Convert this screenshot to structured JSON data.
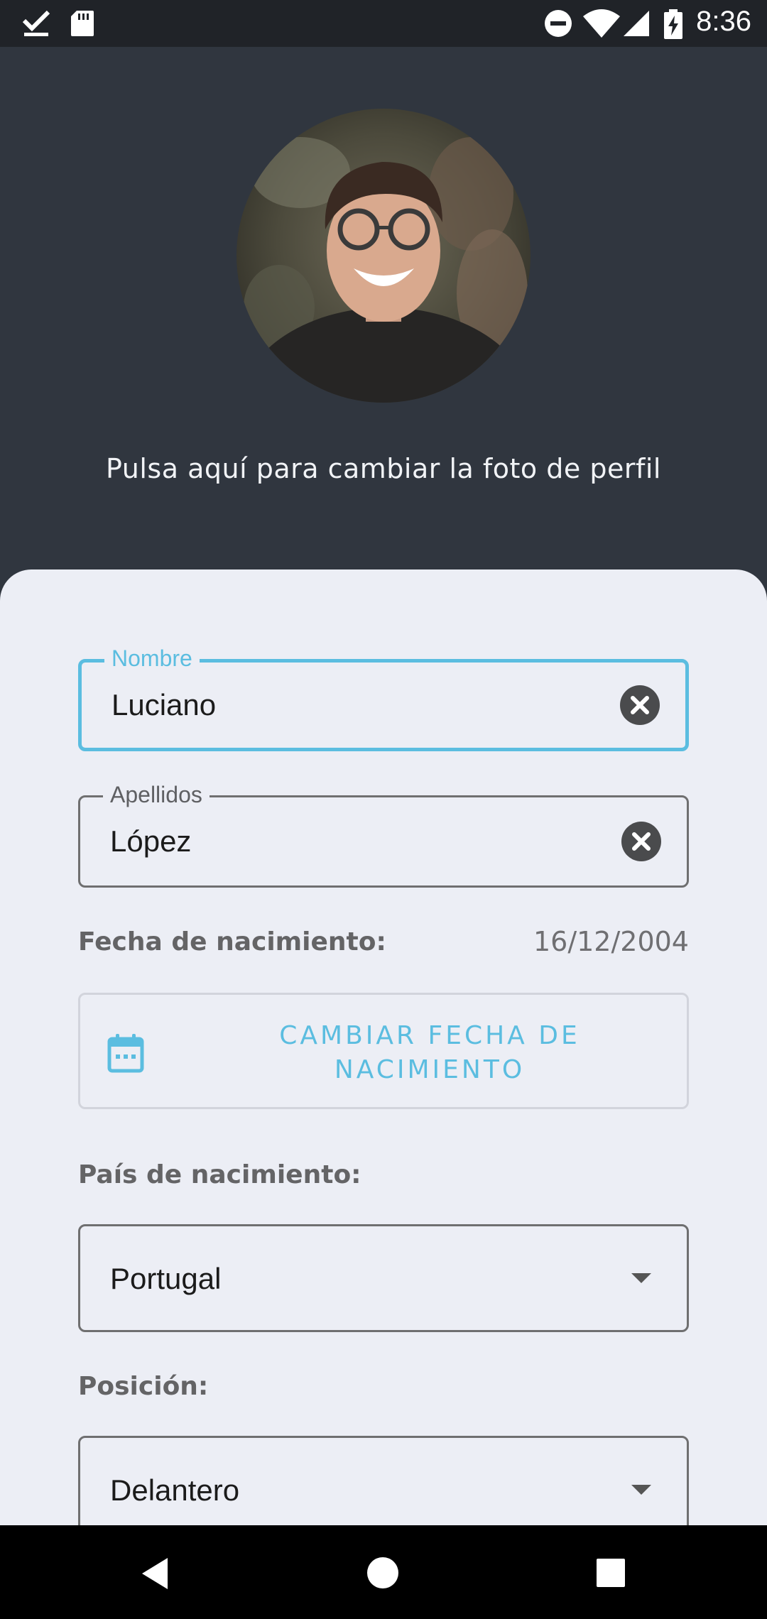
{
  "status_bar": {
    "time": "8:36",
    "icons": [
      "download-done-icon",
      "sd-card-icon",
      "do-not-disturb-icon",
      "wifi-icon",
      "signal-icon",
      "battery-charging-icon"
    ]
  },
  "profile": {
    "change_photo_text": "Pulsa aquí para cambiar la foto de perfil"
  },
  "form": {
    "first_name": {
      "label": "Nombre",
      "value": "Luciano"
    },
    "last_name": {
      "label": "Apellidos",
      "value": "López"
    },
    "birth_date": {
      "label": "Fecha de nacimiento:",
      "value": "16/12/2004",
      "button_label": "CAMBIAR FECHA DE NACIMIENTO"
    },
    "birth_country": {
      "label": "País de nacimiento:",
      "value": "Portugal"
    },
    "position": {
      "label": "Posición:",
      "value": "Delantero"
    }
  },
  "colors": {
    "header_bg": "#30363f",
    "card_bg": "#eceef5",
    "accent": "#5bbde0"
  },
  "nav_bar": {
    "icons": [
      "back-icon",
      "home-icon",
      "recents-icon"
    ]
  }
}
